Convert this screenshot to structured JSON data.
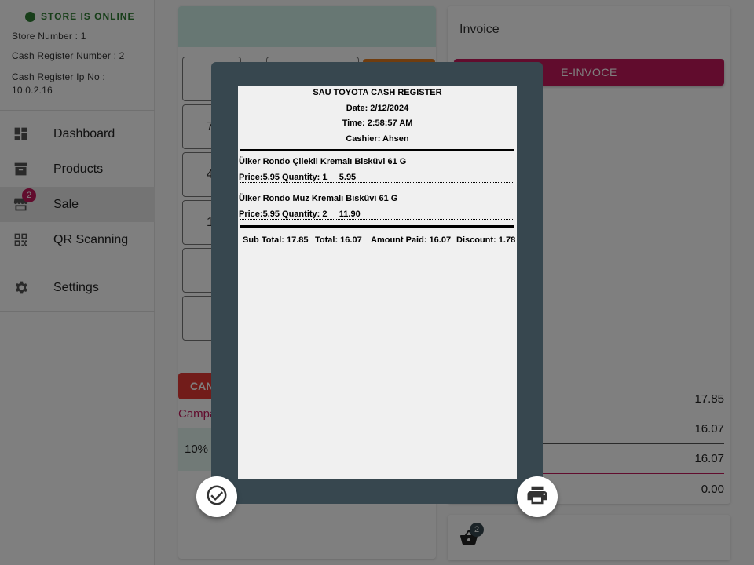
{
  "sidebar": {
    "status": "STORE IS ONLINE",
    "store_number": "Store Number : 1",
    "register_number": "Cash Register Number : 2",
    "register_ip_label": "Cash Register Ip No :",
    "register_ip": "10.0.2.16",
    "items": [
      {
        "label": "Dashboard",
        "icon": "dashboard-icon"
      },
      {
        "label": "Products",
        "icon": "archive-icon"
      },
      {
        "label": "Sale",
        "icon": "store-icon",
        "badge": "2"
      },
      {
        "label": "QR Scanning",
        "icon": "qr-code-icon"
      },
      {
        "label": "Settings",
        "icon": "gear-icon"
      }
    ]
  },
  "middle": {
    "keys": [
      "",
      "",
      "7",
      "4",
      "1",
      "",
      ""
    ],
    "cancel_label": "CAN",
    "campaign_label": "Campa",
    "campaign_chip": "10%"
  },
  "right": {
    "invoice_label": "Invoice",
    "einvoice_label": "E-INVOCE",
    "totals": [
      "17.85",
      "16.07",
      "16.07",
      "0.00"
    ],
    "basket_badge": "2"
  },
  "receipt": {
    "title": "SAU TOYOTA CASH REGISTER",
    "date": "Date: 2/12/2024",
    "time": "Time: 2:58:57 AM",
    "cashier": "Cashier: Ahsen",
    "items": [
      {
        "name": "Ülker Rondo Çilekli Kremalı Bisküvi 61 G",
        "detail": "Price:5.95 Quantity: 1     5.95"
      },
      {
        "name": "Ülker Rondo Muz Kremalı Bisküvi 61 G",
        "detail": "Price:5.95 Quantity: 2     11.90"
      }
    ],
    "summary": {
      "subtotal": "Sub Total: 17.85",
      "total": "Total: 16.07",
      "paid": "Amount Paid: 16.07",
      "discount": "Discount: 1.78"
    }
  },
  "colors": {
    "accent": "#c2185b",
    "modal": "#37474f",
    "online": "#2e7d32"
  }
}
